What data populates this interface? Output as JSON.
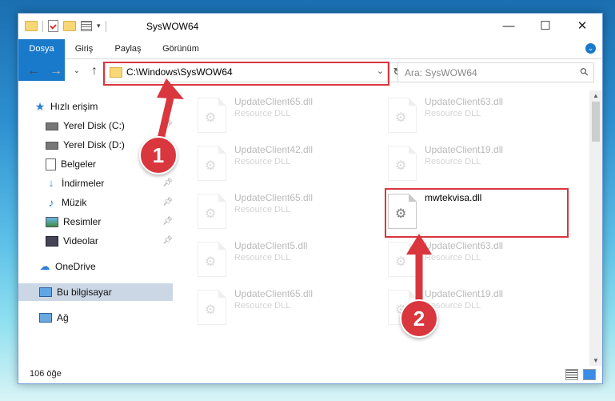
{
  "window": {
    "title": "SysWOW64",
    "controls": {
      "minimize": "—",
      "maximize": "☐",
      "close": "✕"
    }
  },
  "ribbon": {
    "tabs": [
      "Dosya",
      "Giriş",
      "Paylaş",
      "Görünüm"
    ],
    "expand_glyph": "⌄"
  },
  "nav": {
    "back": "←",
    "forward": "→",
    "recent": "⌄",
    "up": "↑",
    "address": "C:\\Windows\\SysWOW64",
    "address_chevron": "⌄",
    "refresh": "↻",
    "search_placeholder": "Ara: SysWOW64",
    "search_icon": "⚲"
  },
  "sidebar": {
    "items": [
      {
        "label": "Hızlı erişim",
        "icon": "star-icon"
      },
      {
        "label": "Yerel Disk (C:)",
        "icon": "drive-icon",
        "pinned": true
      },
      {
        "label": "Yerel Disk (D:)",
        "icon": "drive-icon",
        "pinned": true
      },
      {
        "label": "Belgeler",
        "icon": "documents-icon",
        "pinned": true
      },
      {
        "label": "İndirmeler",
        "icon": "download-icon",
        "pinned": true
      },
      {
        "label": "Müzik",
        "icon": "music-icon",
        "pinned": true
      },
      {
        "label": "Resimler",
        "icon": "pictures-icon",
        "pinned": true
      },
      {
        "label": "Videolar",
        "icon": "videos-icon",
        "pinned": true
      },
      {
        "label": "OneDrive",
        "icon": "cloud-icon"
      },
      {
        "label": "Bu bilgisayar",
        "icon": "computer-icon",
        "selected": true
      },
      {
        "label": "Ağ",
        "icon": "network-icon"
      }
    ]
  },
  "files": [
    {
      "name": "UpdateClient65.dll",
      "type": "Resource DLL",
      "faded": true
    },
    {
      "name": "UpdateClient63.dll",
      "type": "Resource DLL",
      "faded": true
    },
    {
      "name": "UpdateClient42.dll",
      "type": "Resource DLL",
      "faded": true
    },
    {
      "name": "UpdateClient19.dll",
      "type": "Resource DLL",
      "faded": true
    },
    {
      "name": "UpdateClient65.dll",
      "type": "Resource DLL",
      "faded": true
    },
    {
      "name": "mwtekvisa.dll",
      "type": "",
      "faded": false
    },
    {
      "name": "UpdateClient5.dll",
      "type": "Resource DLL",
      "faded": true
    },
    {
      "name": "UpdateClient63.dll",
      "type": "Resource DLL",
      "faded": true
    },
    {
      "name": "UpdateClient65.dll",
      "type": "Resource DLL",
      "faded": true
    },
    {
      "name": "UpdateClient19.dll",
      "type": "Resource DLL",
      "faded": true
    }
  ],
  "status": {
    "item_count": "106 öğe"
  },
  "annotations": {
    "step1": "1",
    "step2": "2",
    "color": "#d9363e"
  }
}
